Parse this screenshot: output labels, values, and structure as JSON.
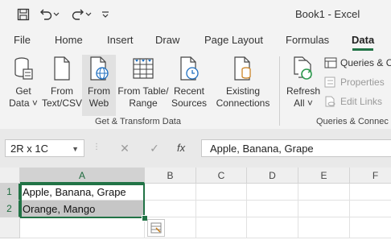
{
  "window": {
    "title": "Book1  -  Excel"
  },
  "qat": {
    "icons": [
      "save-icon",
      "undo-icon",
      "dropdown-icon",
      "redo-icon",
      "dropdown-icon",
      "customize-qat-icon"
    ]
  },
  "ribbon_tabs": [
    "File",
    "Home",
    "Insert",
    "Draw",
    "Page Layout",
    "Formulas",
    "Data"
  ],
  "active_tab": "Data",
  "ribbon": {
    "get_transform": {
      "get_data": {
        "line1": "Get",
        "line2": "Data ˅"
      },
      "from_text": {
        "line1": "From",
        "line2": "Text/CSV"
      },
      "from_web": {
        "line1": "From",
        "line2": "Web"
      },
      "from_table": {
        "line1": "From Table/",
        "line2": "Range"
      },
      "recent_sources": {
        "line1": "Recent",
        "line2": "Sources"
      },
      "existing_connections": {
        "line1": "Existing",
        "line2": "Connections"
      },
      "group_label": "Get & Transform Data"
    },
    "queries": {
      "refresh": {
        "line1": "Refresh",
        "line2": "All ˅"
      },
      "queries_connections": "Queries & C",
      "properties": "Properties",
      "edit_links": "Edit Links",
      "group_label": "Queries & Connec"
    }
  },
  "formula_bar": {
    "name_box": "2R x 1C",
    "cancel": "✕",
    "enter": "✓",
    "fx": "fx",
    "value": "Apple, Banana, Grape"
  },
  "sheet": {
    "columns": [
      "A",
      "B",
      "C",
      "D",
      "E",
      "F"
    ],
    "selected_column": "A",
    "rows": [
      {
        "num": "1",
        "cells": [
          "Apple, Banana, Grape",
          "",
          "",
          "",
          "",
          ""
        ]
      },
      {
        "num": "2",
        "cells": [
          "Orange, Mango",
          "",
          "",
          "",
          "",
          ""
        ]
      },
      {
        "num": "",
        "cells": [
          "",
          "",
          "",
          "",
          "",
          ""
        ]
      }
    ],
    "selection": "A1:A2"
  },
  "colors": {
    "accent": "#217346",
    "ribbon_bg": "#f3f3f3",
    "selection_fill": "#c6c6c6"
  }
}
